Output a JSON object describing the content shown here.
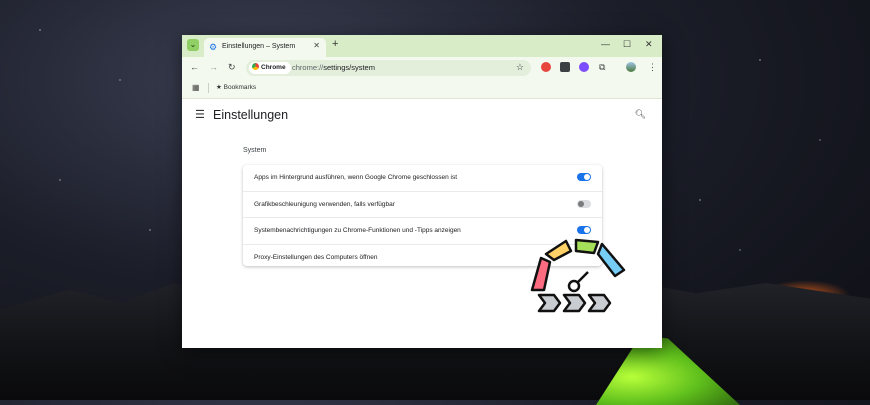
{
  "browser": {
    "tab_title": "Einstellungen – System",
    "new_tab": "+",
    "address_chip": "Chrome",
    "url_prefix": "chrome://",
    "url_path": "settings/system",
    "bookmarks_label": "Bookmarks"
  },
  "settings": {
    "page_title": "Einstellungen",
    "section_title": "System",
    "rows": [
      {
        "label": "Apps im Hintergrund ausführen, wenn Google Chrome geschlossen ist",
        "state": "on"
      },
      {
        "label": "Grafikbeschleunigung verwenden, falls verfügbar",
        "state": "off"
      },
      {
        "label": "Systembenachrichtigungen zu Chrome-Funktionen und -Tipps anzeigen",
        "state": "on"
      },
      {
        "label": "Proxy-Einstellungen des Computers öffnen",
        "state": "link"
      }
    ]
  },
  "colors": {
    "accent": "#1a73e8",
    "tabbar": "#d9ecc8",
    "toolbar": "#f3f9ee"
  },
  "icons": [
    "tab-dropdown-icon",
    "settings-gear-icon",
    "close-icon",
    "back-icon",
    "forward-icon",
    "reload-icon",
    "bookmark-star-icon",
    "extensions-icon",
    "profile-avatar-icon",
    "menu-kebab-icon",
    "apps-grid-icon",
    "hamburger-menu-icon",
    "search-icon",
    "speedometer-gauge-icon"
  ]
}
